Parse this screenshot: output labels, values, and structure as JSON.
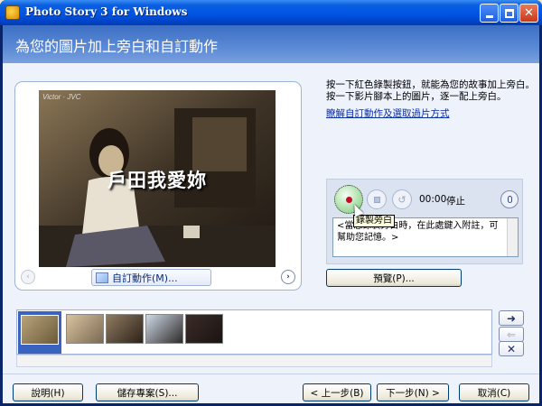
{
  "window": {
    "title": "Photo Story 3 for Windows",
    "controls": {
      "minimize": "minimize",
      "maximize": "maximize",
      "close": "✕"
    }
  },
  "header": {
    "title": "為您的圖片加上旁白和自訂動作"
  },
  "preview": {
    "photo_title": "戶田我愛妳",
    "watermark": "Victor · JVC",
    "prev_icon": "‹",
    "next_icon": "›",
    "customize_motion_label": "自訂動作(M)..."
  },
  "instructions": {
    "text": "按一下紅色錄製按鈕，就能為您的故事加上旁白。按一下影片腳本上的圖片，逐一配上旁白。",
    "link": "瞭解自訂動作及選取過片方式"
  },
  "recording": {
    "time": "00:00",
    "status": "停止",
    "tooltip": "錄製旁白",
    "notes_text": "<當您錄製旁白時，在此處鍵入附註，可幫助您記憶。>"
  },
  "preview_button": "預覽(P)...",
  "filmstrip": {
    "thumbnails": [
      {
        "label": "photo-1",
        "selected": true,
        "colors": [
          "#6b5a3a",
          "#b8a37a"
        ]
      },
      {
        "label": "photo-2",
        "selected": false,
        "colors": [
          "#7a6a52",
          "#d9c2a0"
        ]
      },
      {
        "label": "photo-3",
        "selected": false,
        "colors": [
          "#8f7b62",
          "#2d2218"
        ]
      },
      {
        "label": "photo-4",
        "selected": false,
        "colors": [
          "#cfd9e6",
          "#2e2a2a"
        ]
      },
      {
        "label": "photo-5",
        "selected": false,
        "colors": [
          "#3b2c28",
          "#1a1412"
        ]
      }
    ],
    "move_right_icon": "➜",
    "move_left_icon": "⇐",
    "delete_icon": "✕"
  },
  "buttons": {
    "help": "說明(H)",
    "save": "儲存專案(S)...",
    "back": "< 上一步(B)",
    "next": "下一步(N) >",
    "cancel": "取消(C)"
  },
  "colors": {
    "record_red": "#c80a2a",
    "title_blue": "#0054e3",
    "link_blue": "#0a2ea8"
  }
}
